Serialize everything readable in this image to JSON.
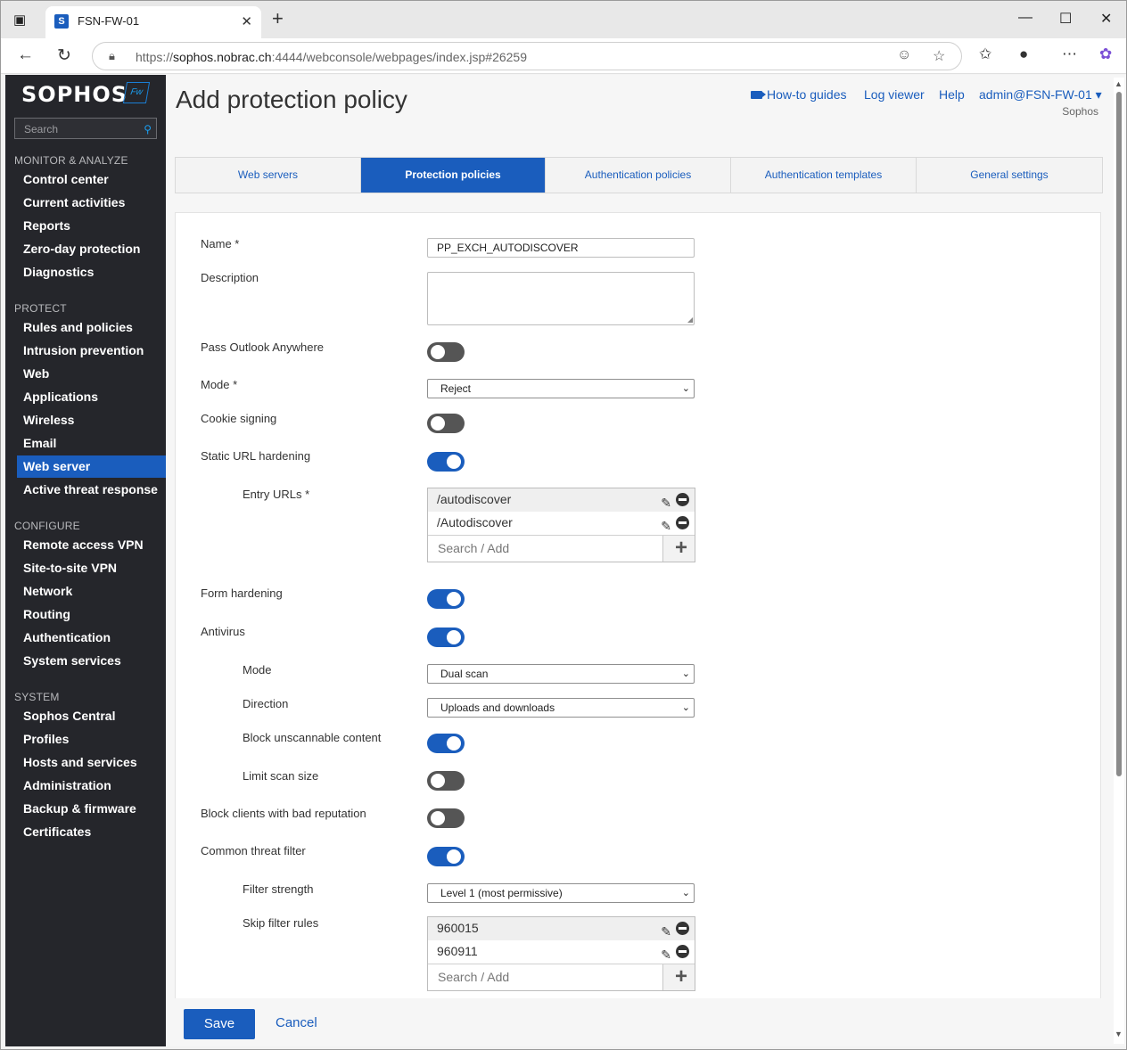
{
  "browser": {
    "tab_title": "FSN-FW-01",
    "url_prefix": "https://",
    "url_host": "sophos.nobrac.ch",
    "url_rest": ":4444/webconsole/webpages/index.jsp#26259"
  },
  "sidebar": {
    "logo": "SOPHOS",
    "badge": "Fw",
    "search_placeholder": "Search",
    "sections": [
      {
        "title": "MONITOR & ANALYZE",
        "items": [
          "Control center",
          "Current activities",
          "Reports",
          "Zero-day protection",
          "Diagnostics"
        ]
      },
      {
        "title": "PROTECT",
        "items": [
          "Rules and policies",
          "Intrusion prevention",
          "Web",
          "Applications",
          "Wireless",
          "Email",
          "Web server",
          "Active threat response"
        ]
      },
      {
        "title": "CONFIGURE",
        "items": [
          "Remote access VPN",
          "Site-to-site VPN",
          "Network",
          "Routing",
          "Authentication",
          "System services"
        ]
      },
      {
        "title": "SYSTEM",
        "items": [
          "Sophos Central",
          "Profiles",
          "Hosts and services",
          "Administration",
          "Backup & firmware",
          "Certificates"
        ]
      }
    ],
    "active_item": "Web server"
  },
  "header": {
    "title": "Add protection policy",
    "links": {
      "howto": "How-to guides",
      "logviewer": "Log viewer",
      "help": "Help",
      "user": "admin@FSN-FW-01 ▾"
    },
    "sub_brand": "Sophos"
  },
  "tabs": [
    "Web servers",
    "Protection policies",
    "Authentication policies",
    "Authentication templates",
    "General settings"
  ],
  "active_tab": "Protection policies",
  "form": {
    "name_label": "Name *",
    "name_value": "PP_EXCH_AUTODISCOVER",
    "description_label": "Description",
    "description_value": "",
    "pass_outlook_label": "Pass Outlook Anywhere",
    "pass_outlook": false,
    "mode_label": "Mode *",
    "mode_value": "Reject",
    "cookie_label": "Cookie signing",
    "cookie": false,
    "static_url_label": "Static URL hardening",
    "static_url": true,
    "entry_urls_label": "Entry URLs *",
    "entry_urls": [
      "/autodiscover",
      "/Autodiscover"
    ],
    "add_placeholder": "Search / Add",
    "form_hardening_label": "Form hardening",
    "form_hardening": true,
    "antivirus_label": "Antivirus",
    "antivirus": true,
    "av_mode_label": "Mode",
    "av_mode_value": "Dual scan",
    "direction_label": "Direction",
    "direction_value": "Uploads and downloads",
    "block_unscannable_label": "Block unscannable content",
    "block_unscannable": true,
    "limit_scan_label": "Limit scan size",
    "limit_scan": false,
    "bad_rep_label": "Block clients with bad reputation",
    "bad_rep": false,
    "ctf_label": "Common threat filter",
    "ctf": true,
    "filter_strength_label": "Filter strength",
    "filter_strength_value": "Level 1 (most permissive)",
    "skip_rules_label": "Skip filter rules",
    "skip_rules": [
      "960015",
      "960911"
    ]
  },
  "footer": {
    "save": "Save",
    "cancel": "Cancel"
  },
  "colors": {
    "accent": "#1a5dbd",
    "sidebar_bg": "#25262b"
  }
}
